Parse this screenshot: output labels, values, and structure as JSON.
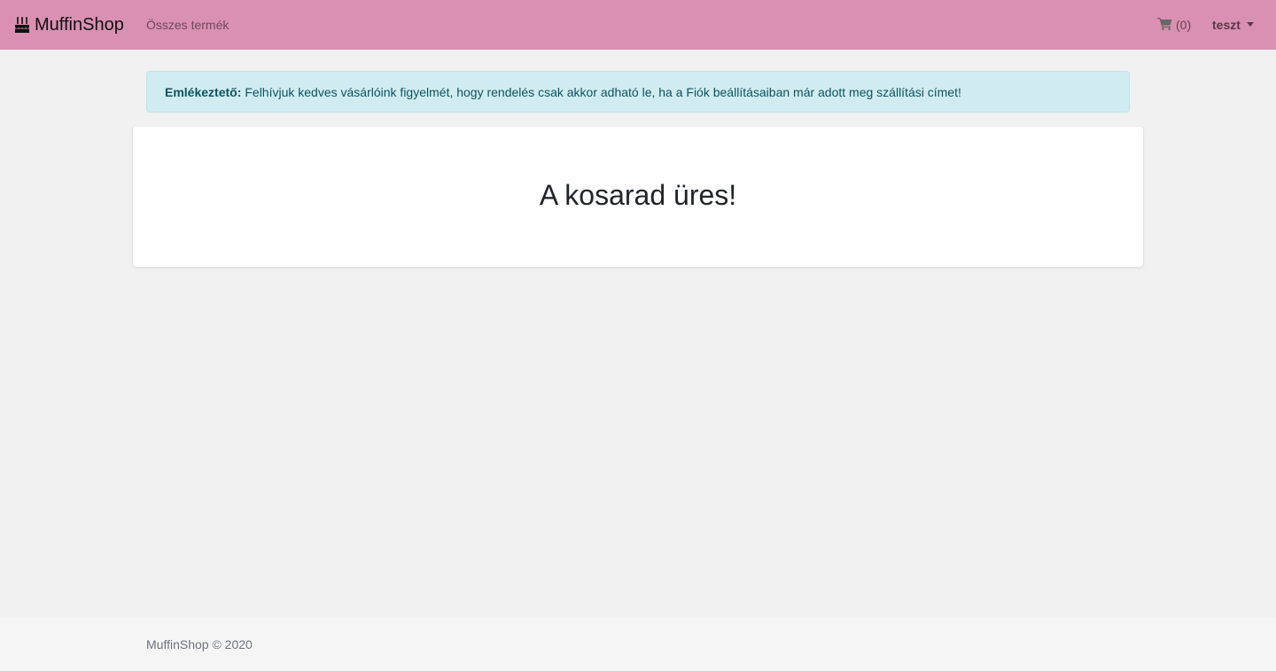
{
  "navbar": {
    "brand_icon": "birthday-cake-icon",
    "brand_name": "MuffinShop",
    "links": [
      {
        "label": "Összes termék"
      }
    ],
    "cart": {
      "icon": "shopping-cart-icon",
      "count_label": "(0)"
    },
    "user": {
      "name": "teszt"
    },
    "background": "#da90b2"
  },
  "alert": {
    "label": "Emlékeztető:",
    "message": "Felhívjuk kedves vásárlóink figyelmét, hogy rendelés csak akkor adható le, ha a Fiók beállításaiban már adott meg szállítási címet!",
    "background": "#d1ecf1",
    "text_color": "#0c5460"
  },
  "main": {
    "empty_cart_message": "A kosarad üres!"
  },
  "footer": {
    "copyright": "MuffinShop © 2020"
  }
}
